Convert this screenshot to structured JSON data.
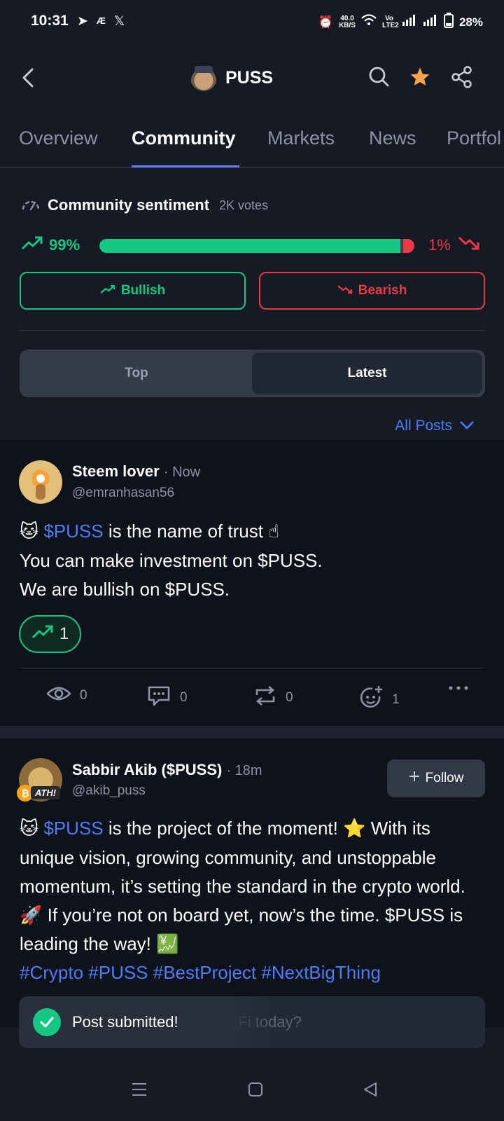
{
  "status_bar": {
    "time": "10:31",
    "net_speed_top": "40.0",
    "net_speed_unit": "KB/S",
    "volte": "Vo LTE2",
    "battery": "28%"
  },
  "header": {
    "title": "PUSS"
  },
  "tabs": [
    {
      "label": "Overview"
    },
    {
      "label": "Community"
    },
    {
      "label": "Markets"
    },
    {
      "label": "News"
    },
    {
      "label": "Portfol"
    }
  ],
  "sentiment": {
    "title": "Community sentiment",
    "votes": "2K votes",
    "bullish_pct": "99%",
    "bearish_pct": "1%",
    "bullish_fraction": 0.99,
    "bearish_fraction": 0.01,
    "bullish_label": "Bullish",
    "bearish_label": "Bearish",
    "bull_color": "#16c784",
    "bear_color": "#ea3943"
  },
  "filter": {
    "top": "Top",
    "latest": "Latest",
    "all_posts": "All Posts"
  },
  "posts": [
    {
      "name": "Steem lover",
      "time": "· Now",
      "handle": "@emranhasan56",
      "line1_tag": "$PUSS",
      "line1_rest": " is the name of trust ☝",
      "line2": "You can make investment on $PUSS.",
      "line3": "We are bullish on $PUSS.",
      "reaction_count": "1",
      "views": "0",
      "comments": "0",
      "reposts": "0",
      "reactions": "1"
    },
    {
      "name": "Sabbir Akib ($PUSS)",
      "time": "· 18m",
      "handle": "@akib_puss",
      "follow": "Follow",
      "badge": "ATH!",
      "body_tag": "$PUSS",
      "body_rest": " is the project of the moment! ⭐ With its unique vision, growing community, and unstoppable momentum, it’s setting the standard in the crypto world. 🚀 If you’re not on board yet, now’s the time. $PUSS is leading the way! 💹",
      "hashtags": "#Crypto #PUSS  #BestProject #NextBigThing"
    }
  ],
  "composer": {
    "placeholder": "el about PussFi today?"
  },
  "toast": {
    "text": "Post submitted!"
  },
  "icons": [
    "back-arrow-icon",
    "search-icon",
    "star-icon",
    "share-icon",
    "gauge-icon",
    "trend-up-icon",
    "trend-down-icon",
    "chevron-down-icon",
    "eye-icon",
    "comment-icon",
    "repost-icon",
    "add-reaction-icon",
    "more-icon",
    "check-icon",
    "menu-icon",
    "home-icon",
    "back-icon"
  ]
}
